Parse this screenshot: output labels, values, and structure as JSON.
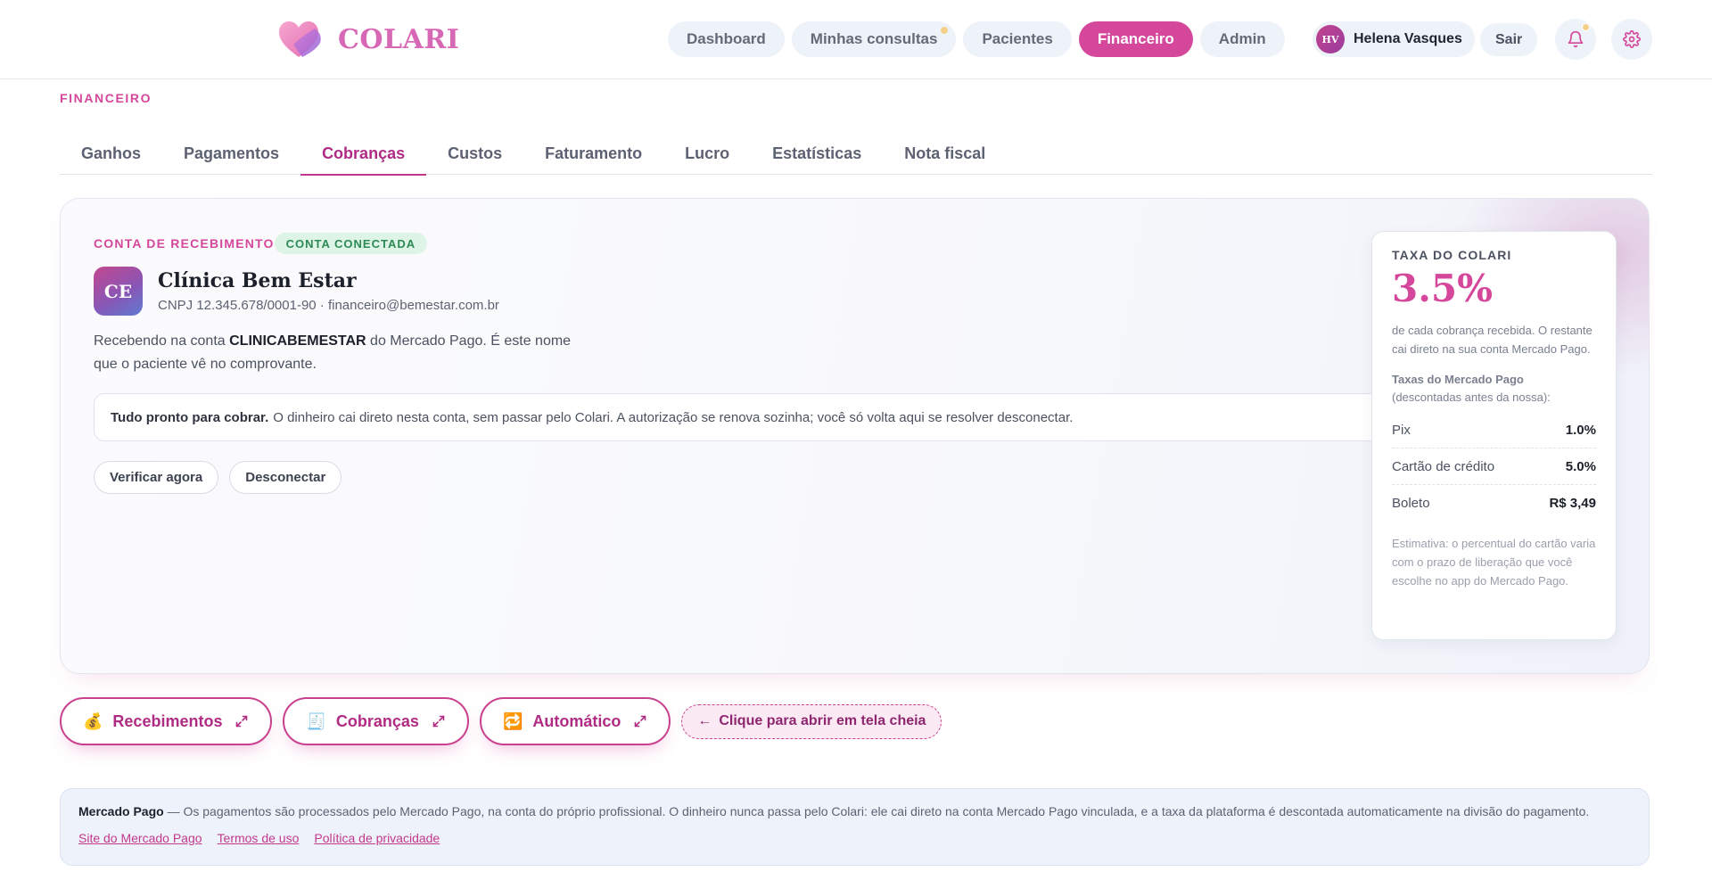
{
  "brand": {
    "name": "COLARI",
    "logo_icon": "heart-logo-icon"
  },
  "nav": {
    "items": [
      {
        "label": "Dashboard",
        "active": false,
        "dot": false
      },
      {
        "label": "Minhas consultas",
        "active": false,
        "dot": true
      },
      {
        "label": "Pacientes",
        "active": false,
        "dot": false
      },
      {
        "label": "Financeiro",
        "active": true,
        "dot": false
      },
      {
        "label": "Admin",
        "active": false,
        "dot": false
      }
    ],
    "user": {
      "initials": "HV",
      "name": "Helena Vasques"
    },
    "logout": "Sair",
    "icons": {
      "notifications": "bell-icon",
      "settings": "gear-icon"
    }
  },
  "section": {
    "label": "FINANCEIRO"
  },
  "tabs": [
    "Ganhos",
    "Pagamentos",
    "Cobranças",
    "Custos",
    "Faturamento",
    "Lucro",
    "Estatísticas",
    "Nota fiscal"
  ],
  "active_tab": "Cobranças",
  "account": {
    "label": "CONTA DE RECEBIMENTO",
    "badge": "CONTA CONECTADA",
    "avatar_initials": "CE",
    "clinic_name": "Clínica Bem Estar",
    "meta": "CNPJ 12.345.678/0001-90 · financeiro@bemestar.com.br",
    "receive_prefix": "Recebendo na conta ",
    "receive_account": "CLINICABEMESTAR",
    "receive_suffix": " do Mercado Pago. É este nome que o paciente vê no comprovante.",
    "ready_bold": "Tudo pronto para cobrar.",
    "ready_text": "O dinheiro cai direto nesta conta, sem passar pelo Colari. A autorização se renova sozinha; você só volta aqui se resolver desconectar.",
    "verify_label": "Verificar agora",
    "disconnect_label": "Desconectar"
  },
  "fee": {
    "title": "TAXA DO COLARI",
    "value": "3.5%",
    "description": "de cada cobrança recebida. O restante cai direto na sua conta Mercado Pago.",
    "mp_title": "Taxas do Mercado Pago",
    "mp_subtitle": "(descontadas antes da nossa):",
    "rows": [
      {
        "label": "Pix",
        "value": "1.0%"
      },
      {
        "label": "Cartão de crédito",
        "value": "5.0%"
      },
      {
        "label": "Boleto",
        "value": "R$ 3,49"
      }
    ],
    "note": "Estimativa: o percentual do cartão varia com o prazo de liberação que você escolhe no app do Mercado Pago."
  },
  "shortcuts": [
    {
      "emoji": "💰",
      "label": "Recebimentos",
      "icon": "expand-icon"
    },
    {
      "emoji": "🧾",
      "label": "Cobranças",
      "icon": "expand-icon"
    },
    {
      "emoji": "🔁",
      "label": "Automático",
      "icon": "expand-icon"
    }
  ],
  "fullscreen_hint": {
    "arrow": "←",
    "label": "Clique para abrir em tela cheia"
  },
  "mp_info": {
    "bold": "Mercado Pago",
    "text": " — Os pagamentos são processados pelo Mercado Pago, na conta do próprio profissional. O dinheiro nunca passa pelo Colari: ele cai direto na conta Mercado Pago vinculada, e a taxa da plataforma é descontada automaticamente na divisão do pagamento.",
    "links": [
      "Site do Mercado Pago",
      "Termos de uso",
      "Política de privacidade"
    ]
  },
  "colors": {
    "accent": "#d4479b",
    "accent_dark": "#b02b84",
    "success": "#2e8a55",
    "info_bg": "#eef2fb"
  }
}
